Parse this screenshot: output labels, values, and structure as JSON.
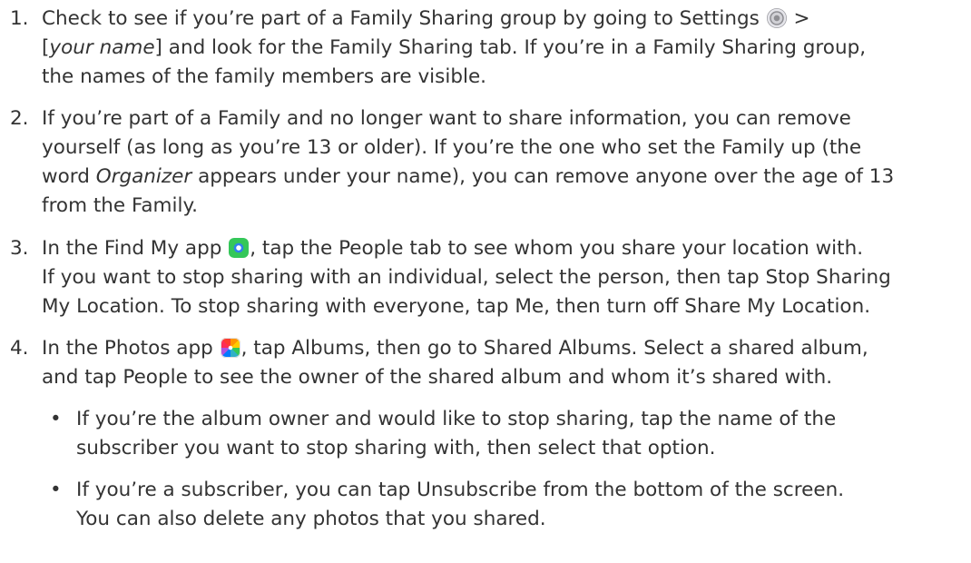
{
  "items": [
    {
      "number": "1.",
      "l1": "Check to see if you’re part of a Family Sharing group by going to Settings",
      "l1_icon": "settings-icon",
      "l1_after": " >",
      "l2_pre": "[",
      "l2_em": "your name",
      "l2_post": "] and look for the Family Sharing tab. If you’re in a Family Sharing group,",
      "l3": "the names of the family members are visible."
    },
    {
      "number": "2.",
      "l1": "If you’re part of a Family and no longer want to share information, you can remove",
      "l2": "yourself (as long as you’re 13 or older). If you’re the one who set the Family up (the",
      "l3_pre": "word ",
      "l3_em": "Organizer",
      "l3_post": " appears under your name), you can remove anyone over the age of 13",
      "l4": "from the Family."
    },
    {
      "number": "3.",
      "l1_pre": "In the Find My app ",
      "l1_icon": "find-my-icon",
      "l1_post": ", tap the People tab to see whom you share your location with.",
      "l2": "If you want to stop sharing with an individual, select the person, then tap Stop Sharing",
      "l3": "My Location. To stop sharing with everyone, tap Me, then turn off Share My Location."
    },
    {
      "number": "4.",
      "l1_pre": "In the Photos app ",
      "l1_icon": "photos-icon",
      "l1_post": ", tap Albums, then go to Shared Albums. Select a shared album,",
      "l2": "and tap People to see the owner of the shared album and whom it’s shared with."
    }
  ],
  "subitems": [
    {
      "bullet": "•",
      "l1": "If you’re the album owner and would like to stop sharing, tap the name of the",
      "l2": "subscriber you want to stop sharing with, then select that option."
    },
    {
      "bullet": "•",
      "l1": "If you’re a subscriber, you can tap Unsubscribe from the bottom of the screen.",
      "l2": "You can also delete any photos that you shared."
    }
  ]
}
